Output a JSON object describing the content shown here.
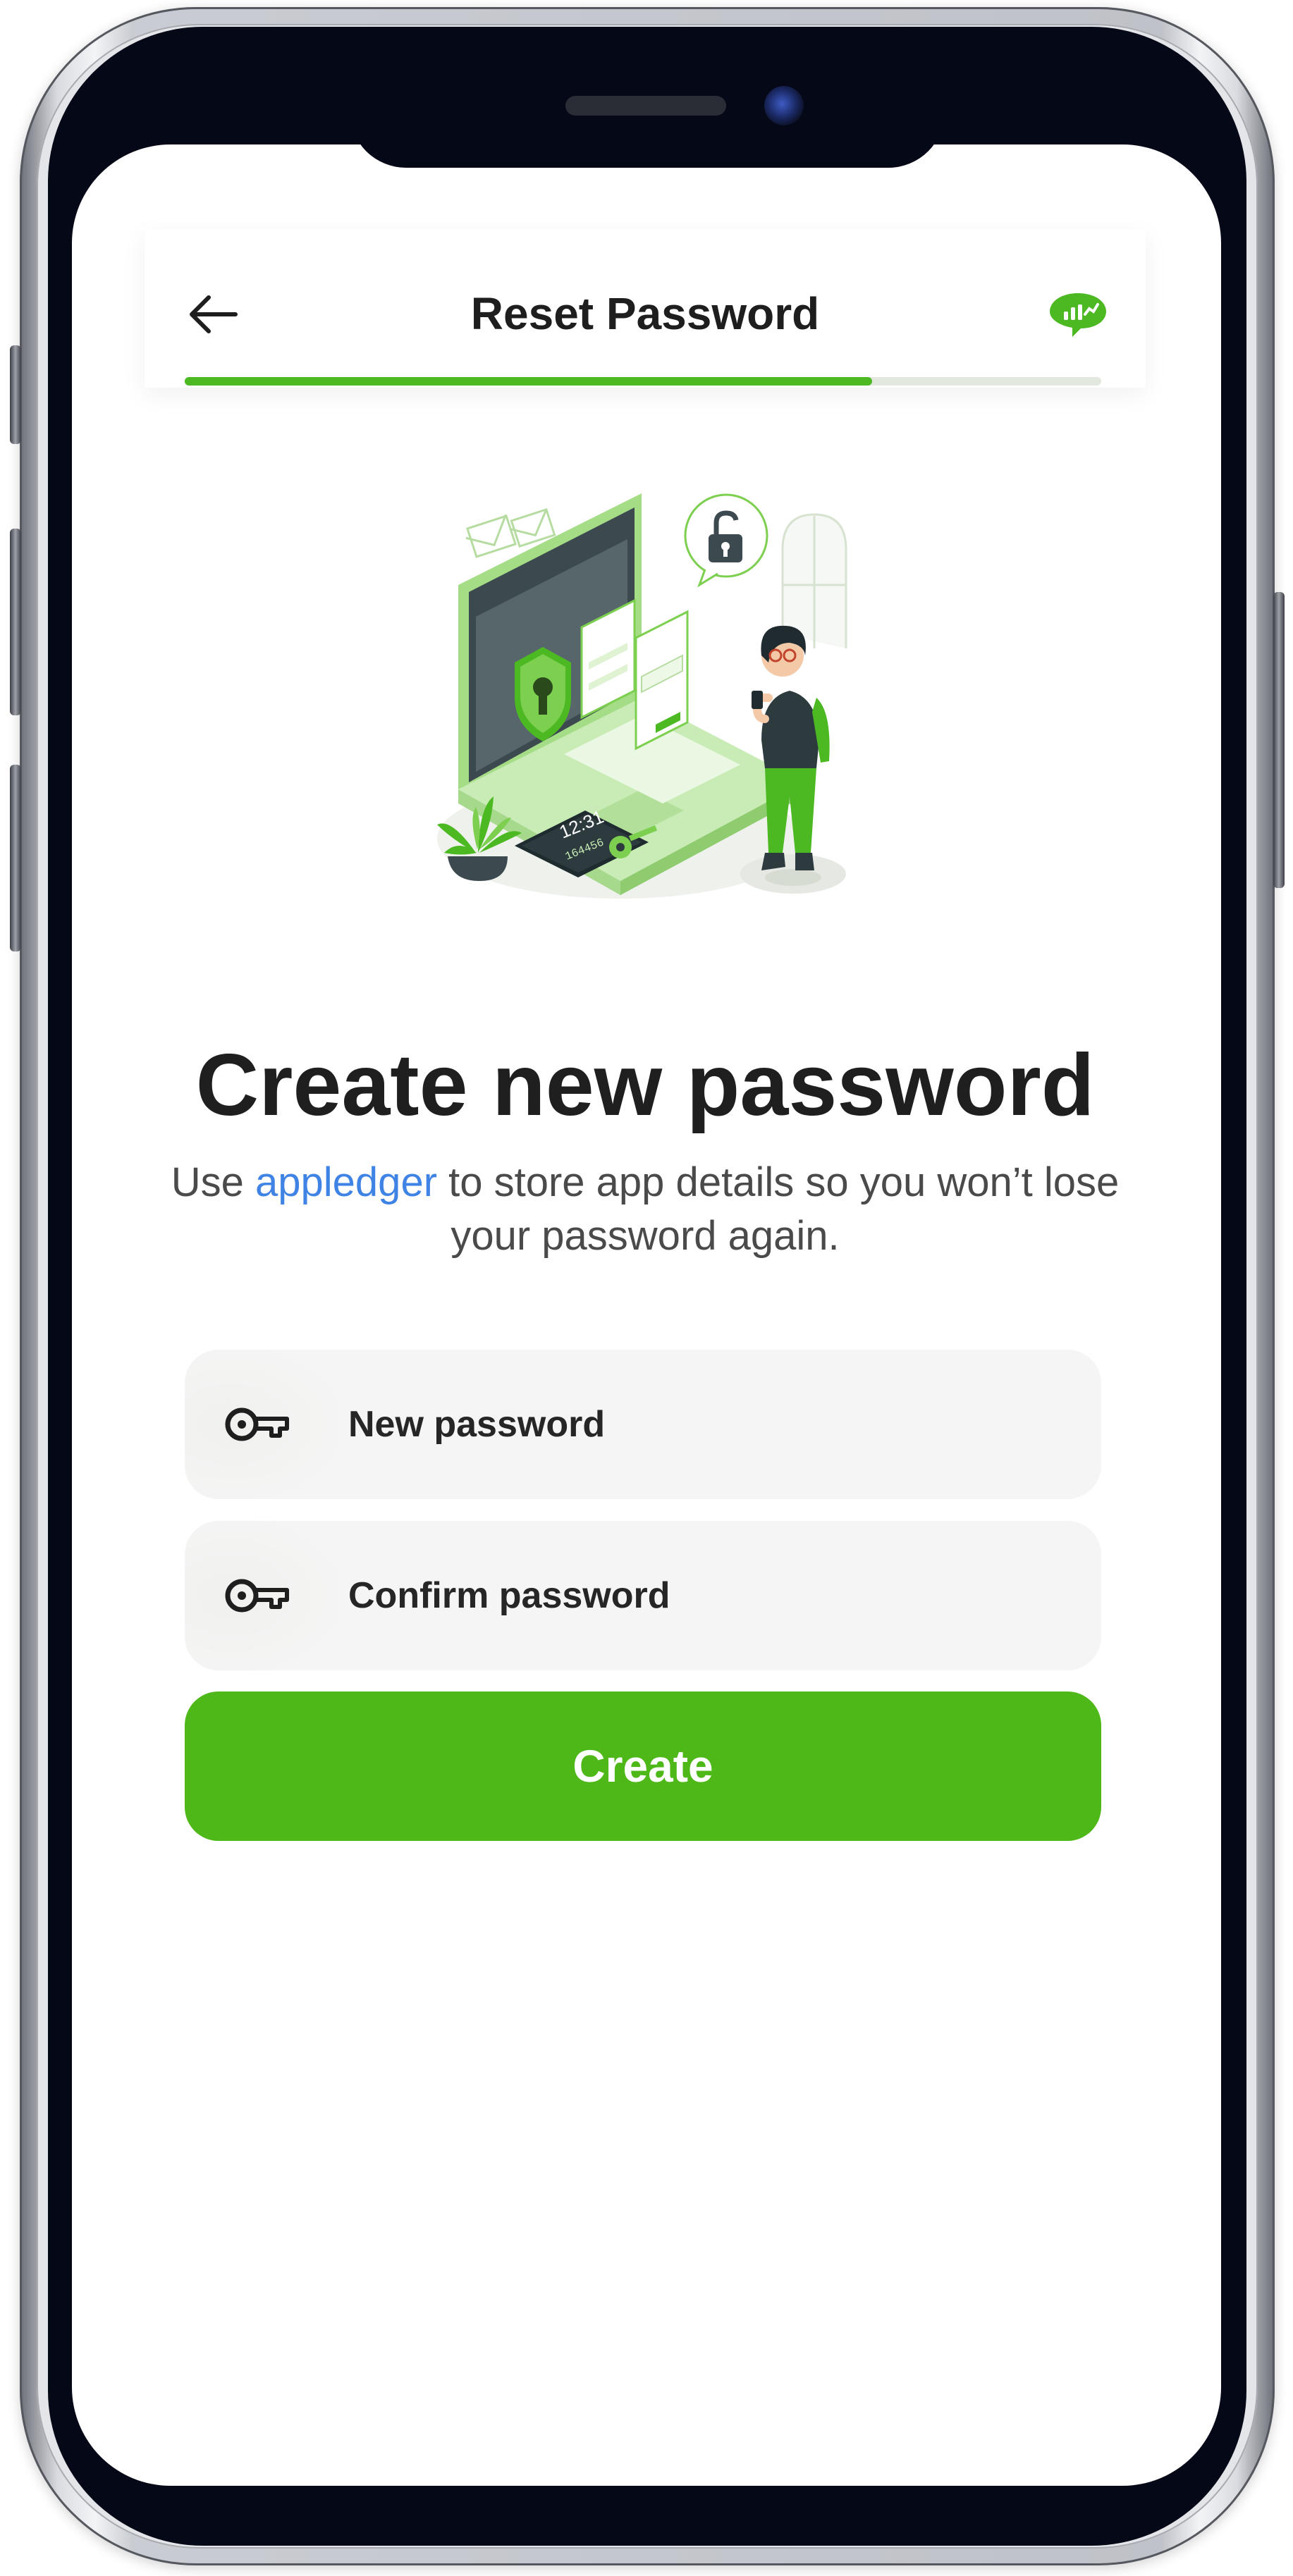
{
  "header": {
    "title": "Reset Password",
    "back_icon": "arrow-left-icon",
    "logo_icon": "chat-bubble-logo-icon",
    "progress": 0.75
  },
  "main": {
    "heading": "Create new password",
    "subtitle_prefix": "Use ",
    "subtitle_link": "appledger",
    "subtitle_suffix": " to store app details so you won’t lose your password again."
  },
  "illustration": {
    "clock": "12:31",
    "code": "164456"
  },
  "form": {
    "new_password_label": "New password",
    "confirm_password_label": "Confirm password",
    "field_icon": "key-icon",
    "submit_label": "Create"
  },
  "colors": {
    "accent": "#4db818",
    "link": "#3f83e5",
    "field_bg": "#f5f5f5"
  }
}
